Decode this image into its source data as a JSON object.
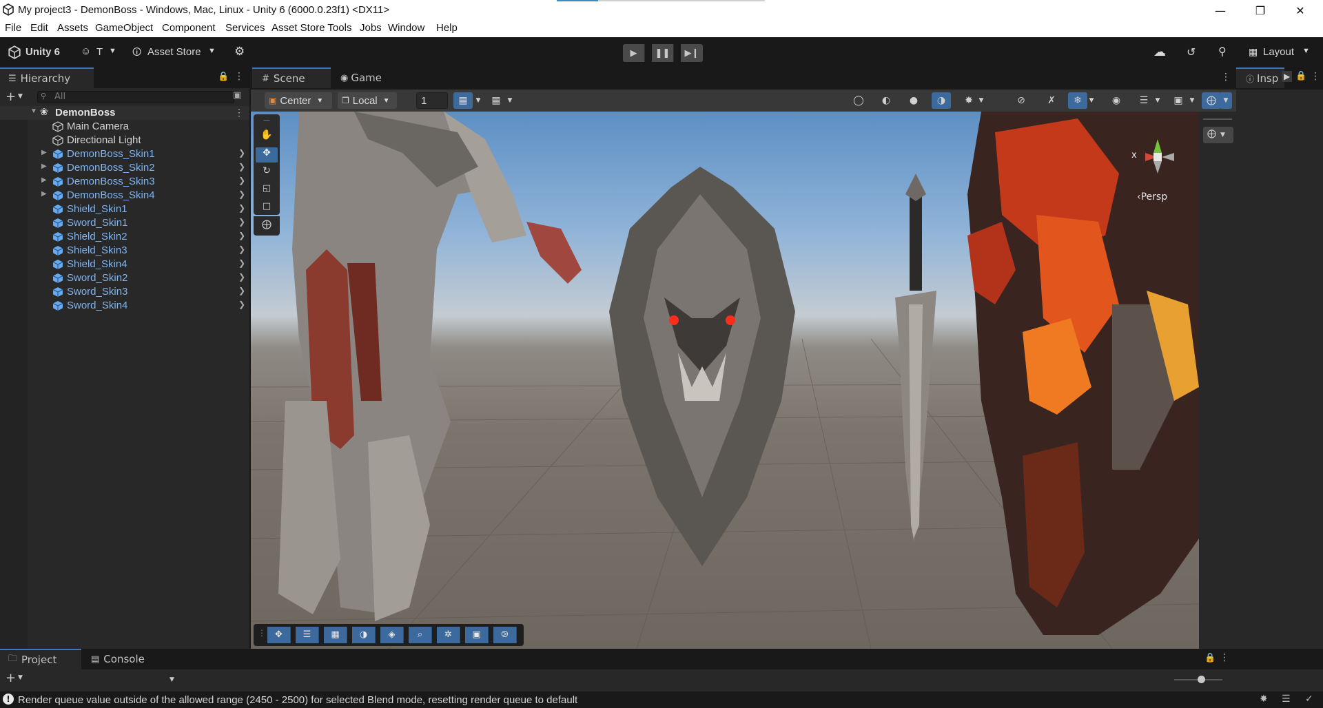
{
  "window": {
    "title": "My project3 - DemonBoss - Windows, Mac, Linux - Unity 6 (6000.0.23f1) <DX11>"
  },
  "menu": [
    "File",
    "Edit",
    "Assets",
    "GameObject",
    "Component",
    "Services",
    "Asset Store Tools",
    "Jobs",
    "Window",
    "Help"
  ],
  "toolbar": {
    "unity_label": "Unity 6",
    "account_label": "T",
    "asset_store_label": "Asset Store",
    "layout_label": "Layout"
  },
  "hierarchy": {
    "tab_label": "Hierarchy",
    "search_placeholder": "All",
    "root": "DemonBoss",
    "items": [
      {
        "label": "Main Camera",
        "type": "normal",
        "icon": "gameobject-icon",
        "foldout": false
      },
      {
        "label": "Directional Light",
        "type": "normal",
        "icon": "gameobject-icon",
        "foldout": false
      },
      {
        "label": "DemonBoss_Skin1",
        "type": "prefab",
        "icon": "prefab-icon",
        "foldout": true
      },
      {
        "label": "DemonBoss_Skin2",
        "type": "prefab",
        "icon": "prefab-icon",
        "foldout": true
      },
      {
        "label": "DemonBoss_Skin3",
        "type": "prefab",
        "icon": "prefab-icon",
        "foldout": true
      },
      {
        "label": "DemonBoss_Skin4",
        "type": "prefab",
        "icon": "prefab-icon",
        "foldout": true
      },
      {
        "label": "Shield_Skin1",
        "type": "prefab",
        "icon": "prefab-icon",
        "foldout": false
      },
      {
        "label": "Sword_Skin1",
        "type": "prefab",
        "icon": "prefab-icon",
        "foldout": false
      },
      {
        "label": "Shield_Skin2",
        "type": "prefab",
        "icon": "prefab-icon",
        "foldout": false
      },
      {
        "label": "Shield_Skin3",
        "type": "prefab",
        "icon": "prefab-icon",
        "foldout": false
      },
      {
        "label": "Shield_Skin4",
        "type": "prefab",
        "icon": "prefab-icon",
        "foldout": false
      },
      {
        "label": "Sword_Skin2",
        "type": "prefab",
        "icon": "prefab-icon",
        "foldout": false
      },
      {
        "label": "Sword_Skin3",
        "type": "prefab",
        "icon": "prefab-icon",
        "foldout": false
      },
      {
        "label": "Sword_Skin4",
        "type": "prefab",
        "icon": "prefab-icon",
        "foldout": false
      }
    ]
  },
  "scene": {
    "tabs": [
      {
        "label": "Scene",
        "icon": "grid-icon"
      },
      {
        "label": "Game",
        "icon": "gamepad-icon"
      }
    ],
    "pivot_label": "Center",
    "space_label": "Local",
    "grid_snap_value": "1",
    "gizmo_persp_label": "Persp",
    "gizmo_x_label": "x"
  },
  "inspector": {
    "tab_label": "Insp"
  },
  "bottom": {
    "tabs": [
      {
        "label": "Project",
        "icon": "folder-icon"
      },
      {
        "label": "Console",
        "icon": "console-icon"
      }
    ]
  },
  "status": {
    "message": "Render queue value outside of the allowed range (2450 - 2500) for selected Blend mode, resetting render queue to default"
  },
  "colors": {
    "accent": "#3a79bb",
    "prefab_text": "#7fb5f2",
    "panel_bg": "#282828",
    "toolbar_bg": "#191919"
  }
}
